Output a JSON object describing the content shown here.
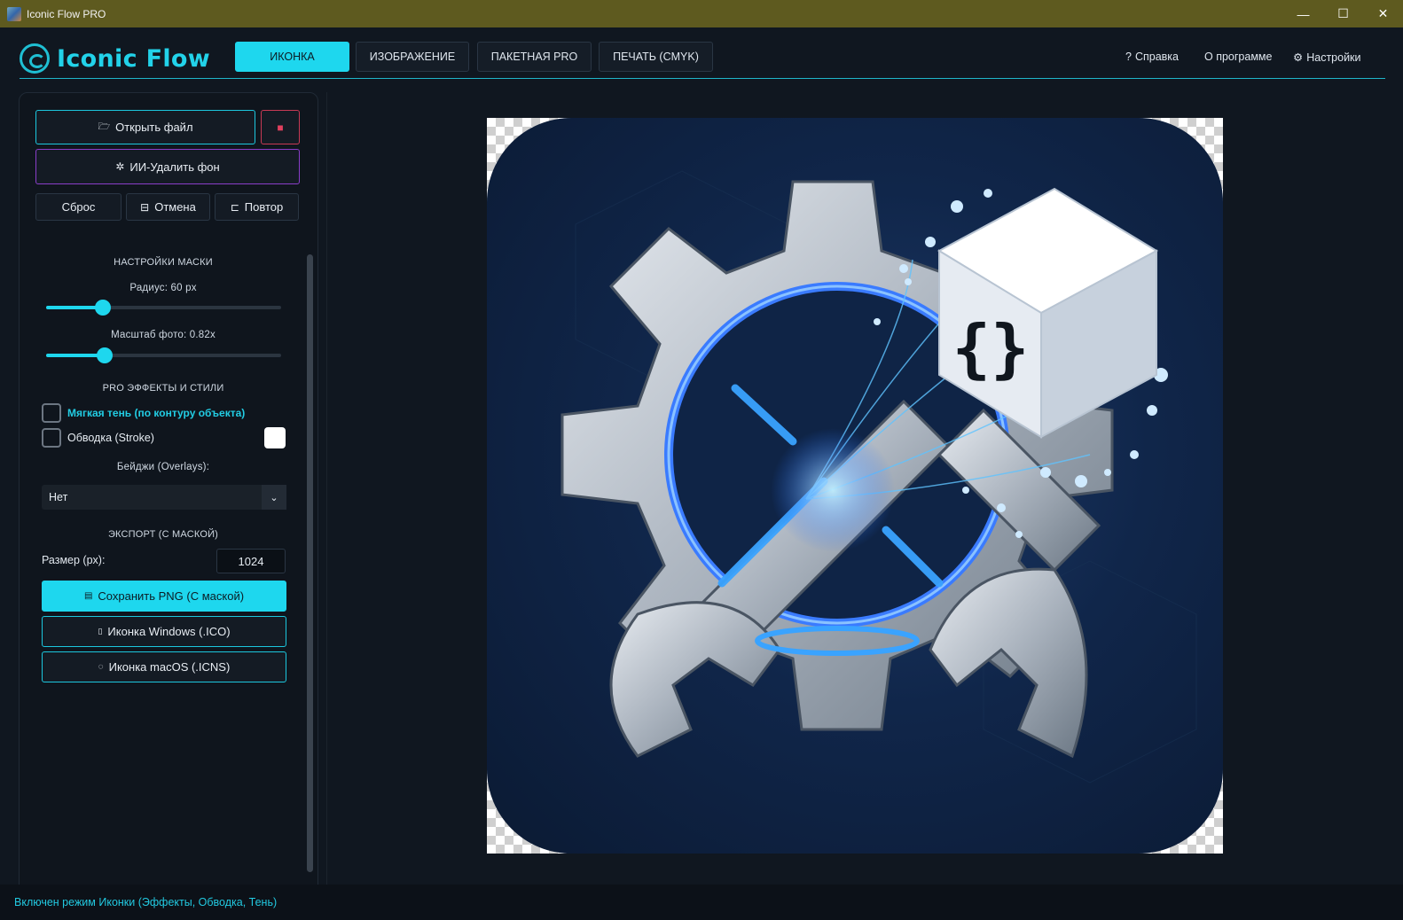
{
  "window": {
    "title": "Iconic Flow PRO",
    "minimize": "—",
    "maximize": "☐",
    "close": "✕"
  },
  "header": {
    "logo_text": "Iconic Flow",
    "tabs": [
      {
        "label": "ИКОНКА",
        "active": true
      },
      {
        "label": "ИЗОБРАЖЕНИЕ",
        "active": false
      },
      {
        "label": "ПАКЕТНАЯ PRO",
        "active": false
      },
      {
        "label": "ПЕЧАТЬ (CMYK)",
        "active": false
      }
    ],
    "links": {
      "help": "Справка",
      "about": "О программе",
      "settings": "Настройки"
    }
  },
  "sidebar": {
    "open_file": "Открыть файл",
    "ai_remove_bg": "ИИ-Удалить фон",
    "reset": "Сброс",
    "undo": "Отмена",
    "redo": "Повтор",
    "mask_section": "НАСТРОЙКИ МАСКИ",
    "radius_label": "Радиус: 60 px",
    "radius_value": 0.24,
    "scale_label": "Масштаб фото: 0.82x",
    "scale_value": 0.25,
    "effects_section": "PRO ЭФФЕКТЫ И СТИЛИ",
    "soft_shadow": "Мягкая тень (по контуру объекта)",
    "stroke": "Обводка (Stroke)",
    "badges_label": "Бейджи (Overlays):",
    "badges_value": "Нет",
    "export_section": "ЭКСПОРТ (С МАСКОЙ)",
    "size_label": "Размер (px):",
    "size_value": "1024",
    "save_png": "Сохранить PNG (С маской)",
    "win_icon": "Иконка Windows (.ICO)",
    "mac_icon": "Иконка macOS (.ICNS)"
  },
  "canvas": {
    "cube_text": "{}"
  },
  "status": "Включен режим Иконки (Эффекты, Обводка, Тень)",
  "colors": {
    "accent": "#1ed7ee",
    "titlebar": "#5e5a1f",
    "background": "#101720",
    "ai_border": "#8a3ec9",
    "delete_border": "#c83a55"
  }
}
